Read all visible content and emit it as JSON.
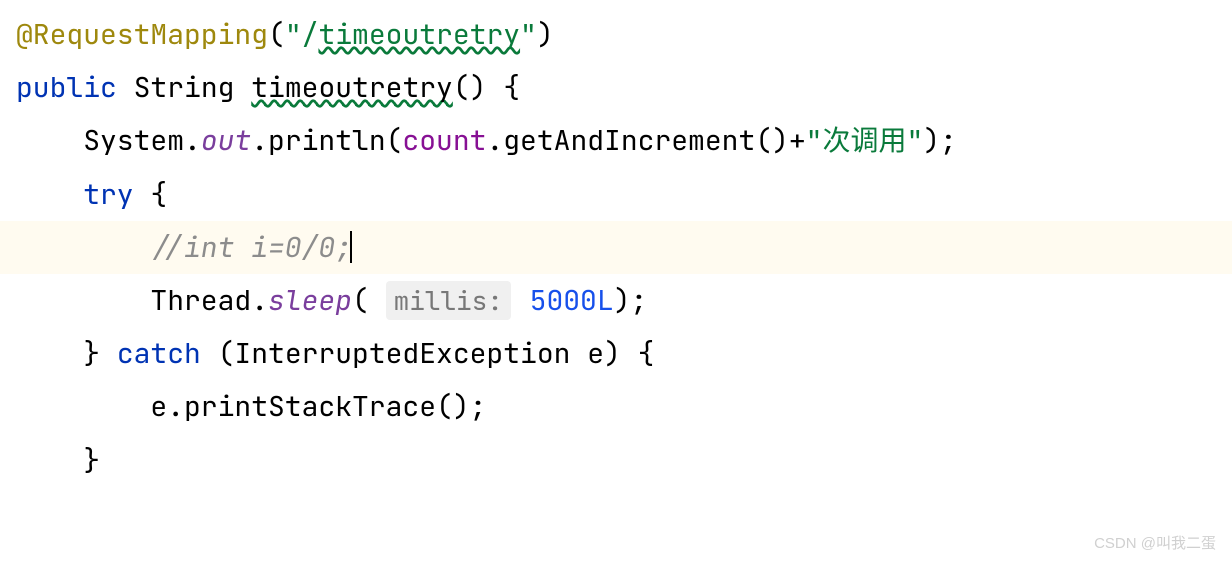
{
  "code": {
    "annotation_name": "@RequestMapping",
    "annotation_path": "\"/timeoutretry\"",
    "path_part1": "\"/",
    "path_wavy": "timeoutretry",
    "path_part2": "\"",
    "keyword_public": "public",
    "type_string": "String",
    "method_name": "timeoutretry",
    "parens_brace": "() {",
    "system": "System.",
    "out": "out",
    "println": ".println(",
    "count": "count",
    "getandinc": ".getAndIncrement()+",
    "string_call": "\"次调用\"",
    "close_println": ");",
    "keyword_try": "try",
    "brace_open": " {",
    "comment": "//int i=0/0;",
    "thread": "Thread.",
    "sleep": "sleep",
    "open_paren": "( ",
    "param_hint": "millis:",
    "sleep_value": "5000L",
    "close_sleep": ");",
    "brace_close": "} ",
    "keyword_catch": "catch",
    "catch_params": " (InterruptedException e) {",
    "stacktrace": "e.printStackTrace();",
    "final_brace": "}"
  },
  "watermark": "CSDN @叫我二蛋"
}
